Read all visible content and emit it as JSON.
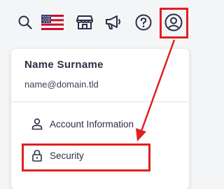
{
  "topbar": {
    "icons": [
      "search-icon",
      "us-flag-icon",
      "store-icon",
      "megaphone-icon",
      "help-icon",
      "account-icon"
    ]
  },
  "account_menu": {
    "name": "Name Surname",
    "email": "name@domain.tld",
    "items": [
      {
        "label": "Account Information",
        "icon": "person-icon"
      },
      {
        "label": "Security",
        "icon": "lock-icon"
      }
    ]
  },
  "annotation": {
    "highlight_color": "#e02020"
  }
}
